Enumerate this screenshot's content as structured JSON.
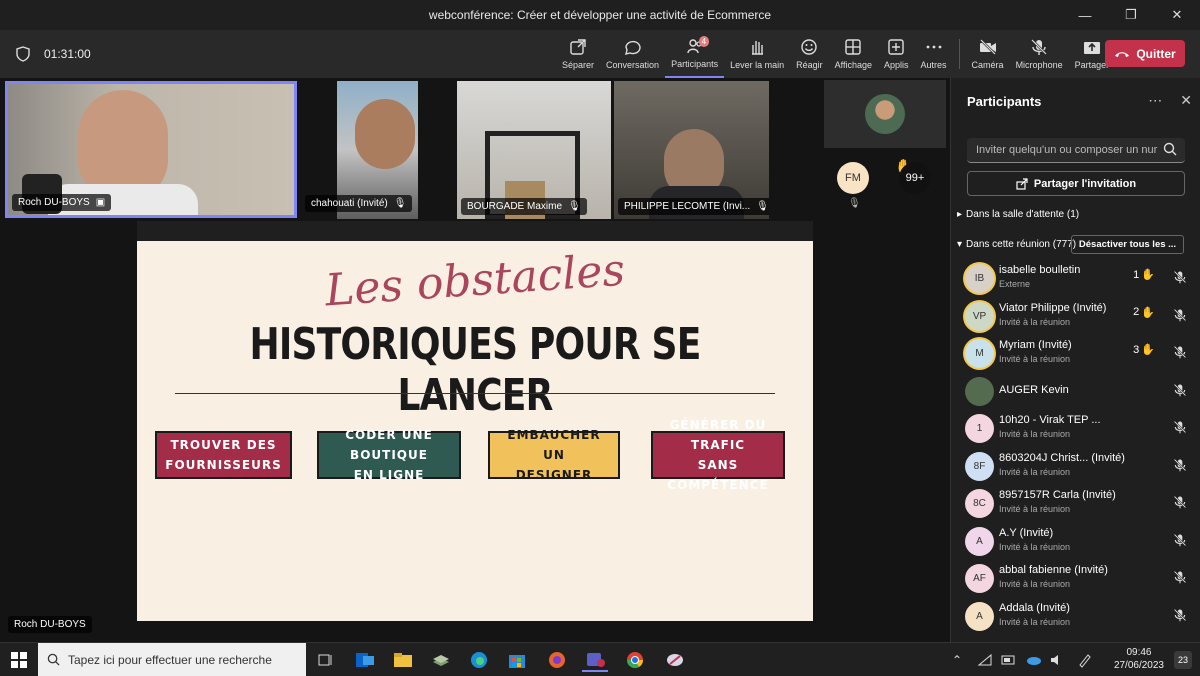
{
  "window": {
    "title": "webconférence: Créer et développer une activité de Ecommerce"
  },
  "toolbar": {
    "timer": "01:31:00",
    "items": [
      {
        "label": "Séparer",
        "icon": "popout-icon"
      },
      {
        "label": "Conversation",
        "icon": "chat-icon"
      },
      {
        "label": "Participants",
        "icon": "people-icon",
        "badge": "4",
        "active": true
      },
      {
        "label": "Lever la main",
        "icon": "raise-hand-icon"
      },
      {
        "label": "Réagir",
        "icon": "smile-icon"
      },
      {
        "label": "Affichage",
        "icon": "grid-icon"
      },
      {
        "label": "Applis",
        "icon": "plus-icon"
      },
      {
        "label": "Autres",
        "icon": "more-icon"
      },
      {
        "label": "Caméra",
        "icon": "camera-off-icon"
      },
      {
        "label": "Microphone",
        "icon": "mic-off-icon"
      },
      {
        "label": "Partager",
        "icon": "share-icon"
      }
    ],
    "quit": "Quitter"
  },
  "video_tiles": [
    {
      "name": "Roch DU-BOYS"
    },
    {
      "name": "chahouati (Invité)"
    },
    {
      "name": "BOURGADE Maxime"
    },
    {
      "name": "PHILIPPE LECOMTE (Invi..."
    }
  ],
  "side": {
    "initials": "FM",
    "count": "99+"
  },
  "slide": {
    "script_title": "Les obstacles",
    "main_title": "HISTORIQUES POUR SE LANCER",
    "cards": [
      {
        "line1": "TROUVER DES",
        "line2": "FOURNISSEURS",
        "bg": "#a32c48",
        "fg": "#ffffff"
      },
      {
        "line1": "CODER UNE BOUTIQUE",
        "line2": "EN LIGNE",
        "bg": "#2f5a51",
        "fg": "#ffffff"
      },
      {
        "line1": "EMBAUCHER UN",
        "line2": "DESIGNER",
        "bg": "#f1c25c",
        "fg": "#1a1a1a"
      },
      {
        "line1": "GÉNÉRER DU TRAFIC",
        "line2": "SANS COMPÉTENCE",
        "bg": "#a32c48",
        "fg": "#ffffff"
      }
    ]
  },
  "presenter_label": "Roch DU-BOYS",
  "panel": {
    "title": "Participants",
    "invite_placeholder": "Inviter quelqu'un ou composer un nur",
    "share_invite": "Partager l'invitation",
    "waiting": "Dans la salle d'attente (1)",
    "in_meeting": "Dans cette réunion (777)",
    "mute_all": "Désactiver tous les ...",
    "participants": [
      {
        "initials": "IB",
        "name": "isabelle boulletin",
        "sub": "Externe",
        "hand": "1",
        "color": "#d9d0c8",
        "ring": true
      },
      {
        "initials": "VP",
        "name": "Viator Philippe (Invité)",
        "sub": "Invité à la réunion",
        "hand": "2",
        "color": "#cdd8c6",
        "ring": true
      },
      {
        "initials": "M",
        "name": "Myriam (Invité)",
        "sub": "Invité à la réunion",
        "hand": "3",
        "color": "#c9e1ea",
        "ring": true
      },
      {
        "initials": "",
        "name": "AUGER Kevin",
        "sub": "",
        "hand": "",
        "color": "#556b4f",
        "ring": false
      },
      {
        "initials": "1",
        "name": "10h20 - Virak TEP ...",
        "sub": "Invité à la réunion",
        "hand": "",
        "color": "#f3d6df",
        "ring": false
      },
      {
        "initials": "8F",
        "name": "8603204J Christ...   (Invité)",
        "sub": "Invité à la réunion",
        "hand": "",
        "color": "#cfe0f5",
        "ring": false
      },
      {
        "initials": "8C",
        "name": "8957157R Carla (Invité)",
        "sub": "Invité à la réunion",
        "hand": "",
        "color": "#f3d6df",
        "ring": false
      },
      {
        "initials": "A",
        "name": "A.Y (Invité)",
        "sub": "Invité à la réunion",
        "hand": "",
        "color": "#f0d6ea",
        "ring": false
      },
      {
        "initials": "AF",
        "name": "abbal fabienne (Invité)",
        "sub": "Invité à la réunion",
        "hand": "",
        "color": "#f3d6df",
        "ring": false
      },
      {
        "initials": "A",
        "name": "Addala (Invité)",
        "sub": "Invité à la réunion",
        "hand": "",
        "color": "#f5e2c4",
        "ring": false
      }
    ]
  },
  "taskbar": {
    "search_placeholder": "Tapez ici pour effectuer une recherche",
    "time": "09:46",
    "date": "27/06/2023",
    "notif": "23"
  }
}
